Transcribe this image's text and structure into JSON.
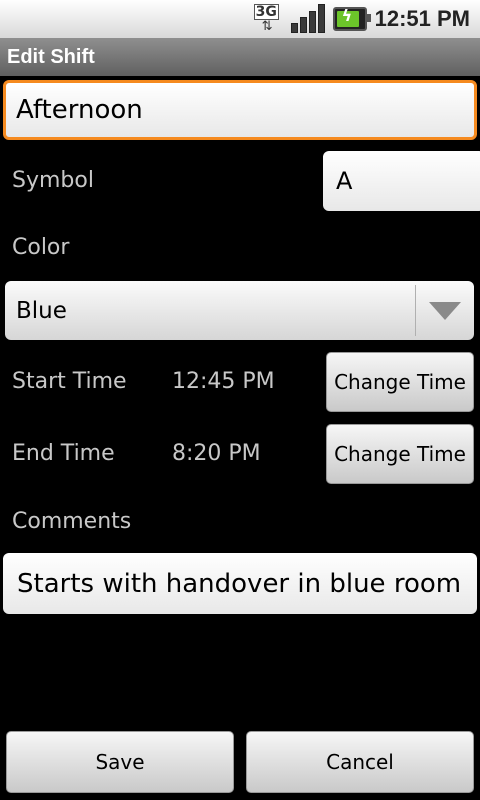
{
  "status_bar": {
    "network_icon": "3g-data-icon",
    "signal_icon": "signal-strength-icon",
    "battery_icon": "battery-charging-icon",
    "network_label": "3G",
    "time": "12:51 PM"
  },
  "title_bar": {
    "title": "Edit Shift"
  },
  "form": {
    "name_value": "Afternoon",
    "symbol_label": "Symbol",
    "symbol_value": "A",
    "color_label": "Color",
    "color_value": "Blue",
    "start_time_label": "Start Time",
    "start_time_value": "12:45 PM",
    "start_change_button": "Change Time",
    "end_time_label": "End Time",
    "end_time_value": "8:20 PM",
    "end_change_button": "Change Time",
    "comments_label": "Comments",
    "comments_value": "Starts with handover in blue room"
  },
  "actions": {
    "save_label": "Save",
    "cancel_label": "Cancel"
  },
  "colors": {
    "focus_accent": "#f58a1f",
    "background": "#000000"
  }
}
